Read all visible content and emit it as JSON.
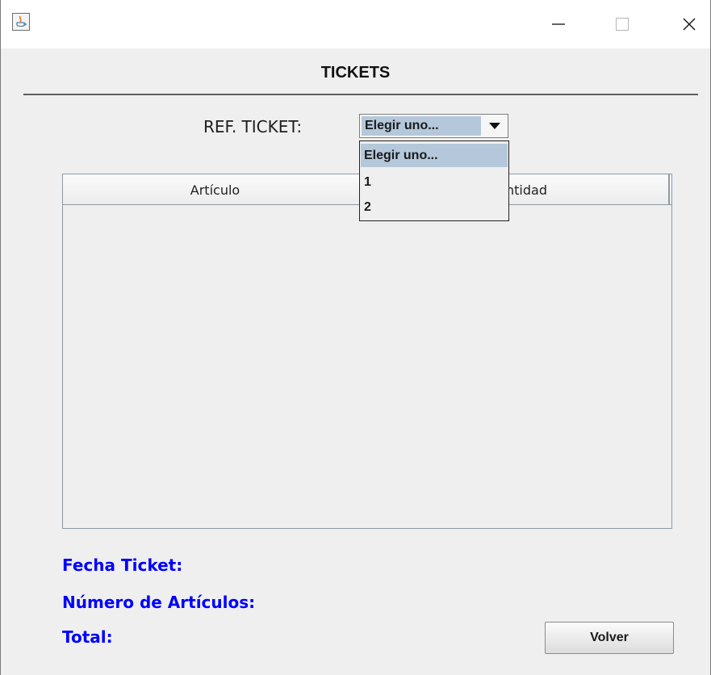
{
  "window": {
    "icon": "java-cup-icon",
    "controls": [
      "minimize-icon",
      "maximize-icon",
      "close-icon"
    ]
  },
  "header": {
    "title": "TICKETS"
  },
  "ref_ticket": {
    "label": "REF. TICKET:",
    "selected": "Elegir uno...",
    "options": [
      "Elegir uno...",
      "1",
      "2"
    ]
  },
  "table": {
    "columns": [
      "Artículo",
      "Cantidad"
    ],
    "rows": []
  },
  "info": {
    "fecha": "Fecha Ticket:",
    "numero": "Número de Artículos:",
    "total": "Total:"
  },
  "actions": {
    "volver": "Volver"
  },
  "colors": {
    "info_text": "#0000ff",
    "selection": "#b5c8db",
    "background": "#efefef"
  }
}
